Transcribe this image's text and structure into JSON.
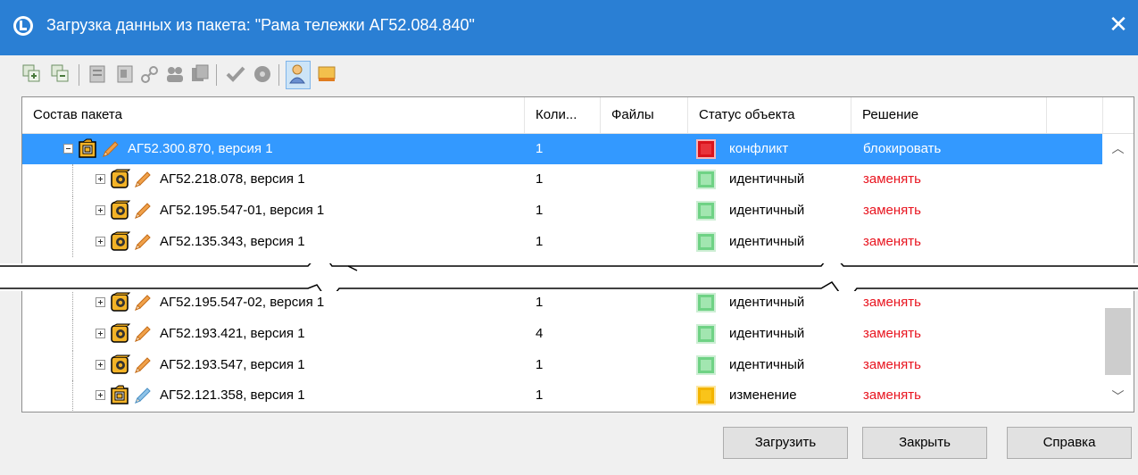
{
  "window": {
    "title": "Загрузка данных из пакета: \"Рама тележки АГ52.084.840\"",
    "close_glyph": "✕"
  },
  "toolbar": {
    "buttons": [
      "add-object-icon",
      "remove-object-icon",
      "properties-icon",
      "document-icon",
      "link-icon",
      "group-icon",
      "copy-icon",
      "check-icon",
      "gear-icon",
      "user-icon",
      "monitor-icon"
    ],
    "active": "user-icon"
  },
  "columns": [
    "Состав пакета",
    "Коли...",
    "Файлы",
    "Статус объекта",
    "Решение"
  ],
  "rows": [
    {
      "name": "АГ52.300.870, версия 1",
      "qty": "1",
      "files": "",
      "status": "конфликт",
      "status_color": "#e8333b",
      "decision": "блокировать",
      "level": 0,
      "icon": "assembly-icon",
      "pencil": "orange",
      "selected": true
    },
    {
      "name": "АГ52.218.078, версия 1",
      "qty": "1",
      "files": "",
      "status": "идентичный",
      "status_color": "#a2e6b0",
      "decision": "заменять",
      "level": 1,
      "icon": "part-icon",
      "pencil": "orange"
    },
    {
      "name": "АГ52.195.547-01, версия 1",
      "qty": "1",
      "files": "",
      "status": "идентичный",
      "status_color": "#a2e6b0",
      "decision": "заменять",
      "level": 1,
      "icon": "part-icon",
      "pencil": "orange"
    },
    {
      "name": "АГ52.135.343, версия 1",
      "qty": "1",
      "files": "",
      "status": "идентичный",
      "status_color": "#a2e6b0",
      "decision": "заменять",
      "level": 1,
      "icon": "part-icon",
      "pencil": "orange"
    },
    {
      "name": "АГ52.195.547-02, версия 1",
      "qty": "1",
      "files": "",
      "status": "идентичный",
      "status_color": "#a2e6b0",
      "decision": "заменять",
      "level": 1,
      "icon": "part-icon",
      "pencil": "orange"
    },
    {
      "name": "АГ52.193.421, версия 1",
      "qty": "4",
      "files": "",
      "status": "идентичный",
      "status_color": "#a2e6b0",
      "decision": "заменять",
      "level": 1,
      "icon": "part-icon",
      "pencil": "orange"
    },
    {
      "name": "АГ52.193.547, версия 1",
      "qty": "1",
      "files": "",
      "status": "идентичный",
      "status_color": "#a2e6b0",
      "decision": "заменять",
      "level": 1,
      "icon": "part-icon",
      "pencil": "orange"
    },
    {
      "name": "АГ52.121.358, версия 1",
      "qty": "1",
      "files": "",
      "status": "изменение",
      "status_color": "#f9c41a",
      "decision": "заменять",
      "level": 1,
      "icon": "assembly-icon",
      "pencil": "blue"
    }
  ],
  "buttons": {
    "load": "Загрузить",
    "close": "Закрыть",
    "help": "Справка"
  },
  "colors": {
    "titlebar": "#2a7fd4",
    "selection": "#3399ff",
    "decision_text": "#e8141f"
  }
}
